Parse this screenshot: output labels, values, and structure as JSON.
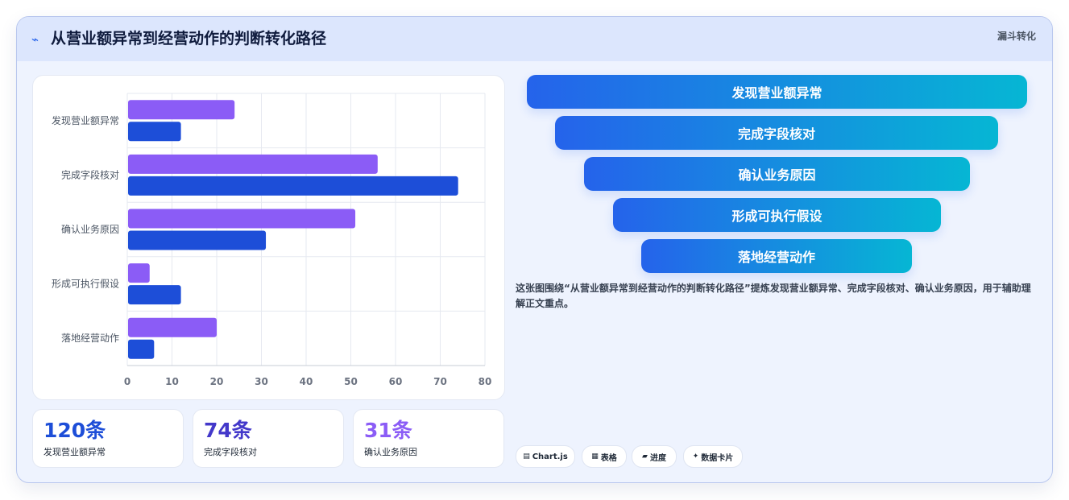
{
  "header": {
    "icon": "lightning-icon",
    "title": "从营业额异常到经营动作的判断转化路径",
    "tag": "漏斗转化"
  },
  "chart_data": {
    "type": "bar",
    "orientation": "horizontal",
    "categories": [
      "发现营业额异常",
      "完成字段核对",
      "确认业务原因",
      "形成可执行假设",
      "落地经营动作"
    ],
    "series": [
      {
        "values": [
          24,
          56,
          51,
          5,
          20
        ],
        "color": "#8b5cf6"
      },
      {
        "values": [
          12,
          74,
          31,
          12,
          6
        ],
        "color": "#1d4ed8"
      }
    ],
    "xlim": [
      0,
      80
    ],
    "xticks": [
      0,
      10,
      20,
      30,
      40,
      50,
      60,
      70,
      80
    ],
    "grid": true,
    "legend": "none"
  },
  "stats": [
    {
      "value": "120条",
      "label": "发现营业额异常",
      "color": "#1d4ed8"
    },
    {
      "value": "74条",
      "label": "完成字段核对",
      "color": "#4338ca"
    },
    {
      "value": "31条",
      "label": "确认业务原因",
      "color": "#8b5cf6"
    }
  ],
  "funnel": [
    "发现营业额异常",
    "完成字段核对",
    "确认业务原因",
    "形成可执行假设",
    "落地经营动作"
  ],
  "description": "这张图围绕“从营业额异常到经营动作的判断转化路径”提炼发现营业额异常、完成字段核对、确认业务原因，用于辅助理解正文重点。",
  "chips": [
    {
      "icon": "chart-icon",
      "glyph": "▤",
      "label": "Chart.js"
    },
    {
      "icon": "table-icon",
      "glyph": "▦",
      "label": "表格"
    },
    {
      "icon": "progress-icon",
      "glyph": "▰",
      "label": "进度"
    },
    {
      "icon": "sparkle-icon",
      "glyph": "✦",
      "label": "数据卡片"
    }
  ]
}
